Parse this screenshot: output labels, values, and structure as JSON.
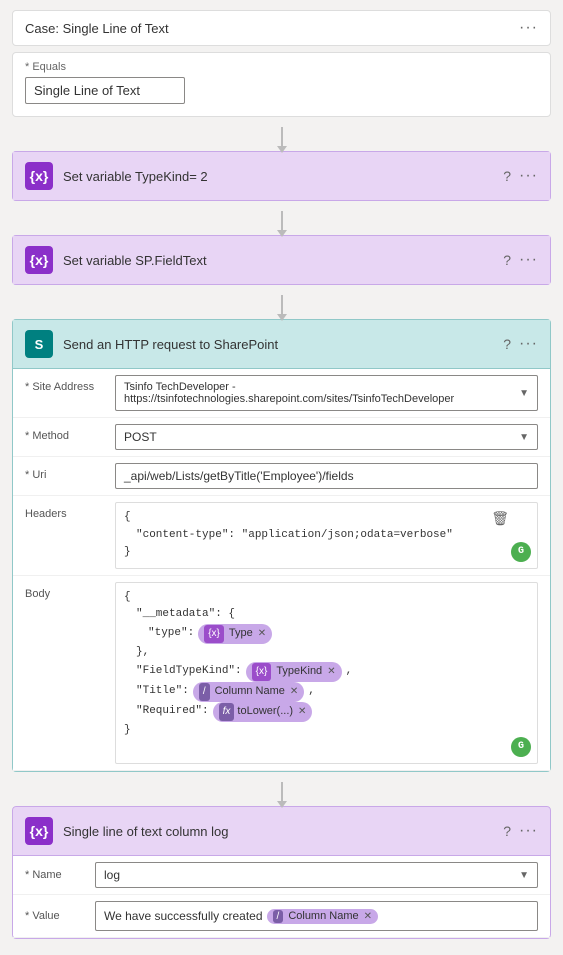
{
  "case_header": {
    "title": "Case: Single Line of Text",
    "dots": "···"
  },
  "equals_section": {
    "label": "* Equals",
    "value": "Single Line of Text"
  },
  "action1": {
    "icon": "{x}",
    "title": "Set variable TypeKind= 2",
    "help": "?",
    "dots": "···"
  },
  "action2": {
    "icon": "{x}",
    "title": "Set variable SP.FieldText",
    "help": "?",
    "dots": "···"
  },
  "http_action": {
    "icon": "S",
    "title": "Send an HTTP request to SharePoint",
    "help": "?",
    "dots": "···",
    "fields": {
      "site_address_label": "* Site Address",
      "site_address_value": "Tsinfo TechDeveloper - https://tsinfotechnologies.sharepoint.com/sites/TsinfoTechDeveloper",
      "method_label": "* Method",
      "method_value": "POST",
      "uri_label": "* Uri",
      "uri_value": "_api/web/Lists/getByTitle('Employee')/fields",
      "headers_label": "Headers",
      "headers_content_line1": "{",
      "headers_content_line2": "\"content-type\": \"application/json;odata=verbose\"",
      "headers_content_line3": "}",
      "body_label": "Body",
      "body_line1": "{",
      "body_line2": "\"__metadata\": {",
      "body_line3": "\"type\":",
      "body_token1_icon": "{x}",
      "body_token1_label": "Type",
      "body_line4": "},",
      "body_line5": "\"FieldTypeKind\":",
      "body_token2_icon": "{x}",
      "body_token2_label": "TypeKind",
      "body_line6": "\"Title\":",
      "body_token3_icon": "/",
      "body_token3_label": "Column Name",
      "body_line7": "\"Required\":",
      "body_token4_icon": "fx",
      "body_token4_label": "toLower(...)",
      "body_line8": "}"
    }
  },
  "log_action": {
    "icon": "{x}",
    "title": "Single line of text column log",
    "help": "?",
    "dots": "···",
    "name_label": "* Name",
    "name_value": "log",
    "value_label": "* Value",
    "value_prefix": "We have successfully created",
    "value_token_icon": "/",
    "value_token_label": "Column Name"
  }
}
